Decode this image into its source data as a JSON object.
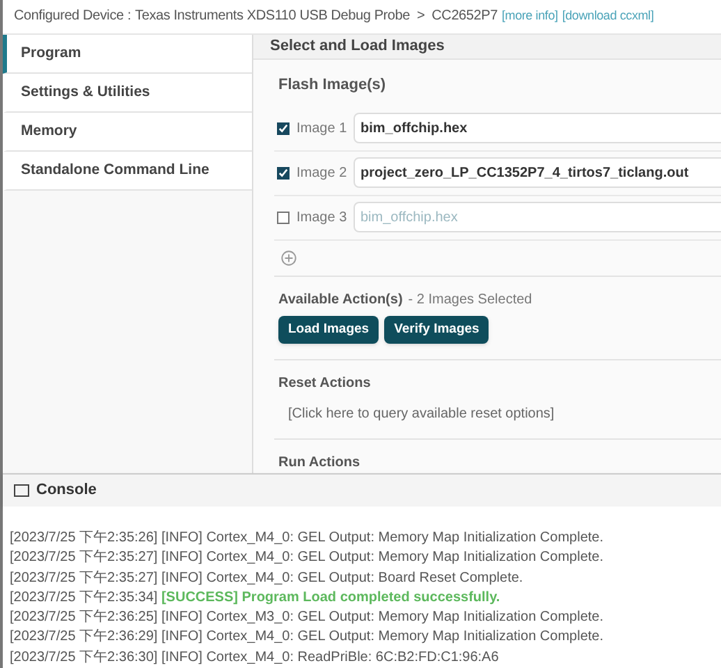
{
  "header": {
    "label": "Configured Device :",
    "device": "Texas Instruments XDS110 USB Debug Probe",
    "separator": ">",
    "target": "CC2652P7",
    "links": [
      "[more info]",
      "[download ccxml]"
    ]
  },
  "sidebar": {
    "items": [
      {
        "label": "Program",
        "selected": true
      },
      {
        "label": "Settings & Utilities",
        "selected": false
      },
      {
        "label": "Memory",
        "selected": false
      },
      {
        "label": "Standalone Command Line",
        "selected": false
      }
    ]
  },
  "panel": {
    "title": "Select and Load Images",
    "flash_title": "Flash Image(s)",
    "images": [
      {
        "label": "Image 1",
        "checked": true,
        "value": "bim_offchip.hex"
      },
      {
        "label": "Image 2",
        "checked": true,
        "value": "project_zero_LP_CC1352P7_4_tirtos7_ticlang.out"
      },
      {
        "label": "Image 3",
        "checked": false,
        "placeholder": "bim_offchip.hex"
      }
    ],
    "actions_title": "Available Action(s)",
    "actions_note": "- 2 Images Selected",
    "buttons": [
      "Load Images",
      "Verify Images"
    ],
    "reset_title": "Reset Actions",
    "reset_link": "[Click here to query available reset options]",
    "run_title": "Run Actions"
  },
  "console": {
    "title": "Console",
    "lines": [
      {
        "time": "[2023/7/25 下午2:35:26]",
        "kind": "info",
        "text": "[INFO] Cortex_M4_0: GEL Output: Memory Map Initialization Complete."
      },
      {
        "time": "[2023/7/25 下午2:35:27]",
        "kind": "info",
        "text": "[INFO] Cortex_M4_0: GEL Output: Memory Map Initialization Complete."
      },
      {
        "time": "[2023/7/25 下午2:35:27]",
        "kind": "info",
        "text": "[INFO] Cortex_M4_0: GEL Output: Board Reset Complete."
      },
      {
        "time": "[2023/7/25 下午2:35:34]",
        "kind": "success",
        "text": "[SUCCESS] Program Load completed successfully."
      },
      {
        "time": "[2023/7/25 下午2:36:25]",
        "kind": "info",
        "text": "[INFO] Cortex_M3_0: GEL Output: Memory Map Initialization Complete."
      },
      {
        "time": "[2023/7/25 下午2:36:29]",
        "kind": "info",
        "text": "[INFO] Cortex_M4_0: GEL Output: Memory Map Initialization Complete."
      },
      {
        "time": "[2023/7/25 下午2:36:30]",
        "kind": "info",
        "text": "[INFO] Cortex_M4_0: ReadPriBle: 6C:B2:FD:C1:96:A6"
      }
    ]
  }
}
